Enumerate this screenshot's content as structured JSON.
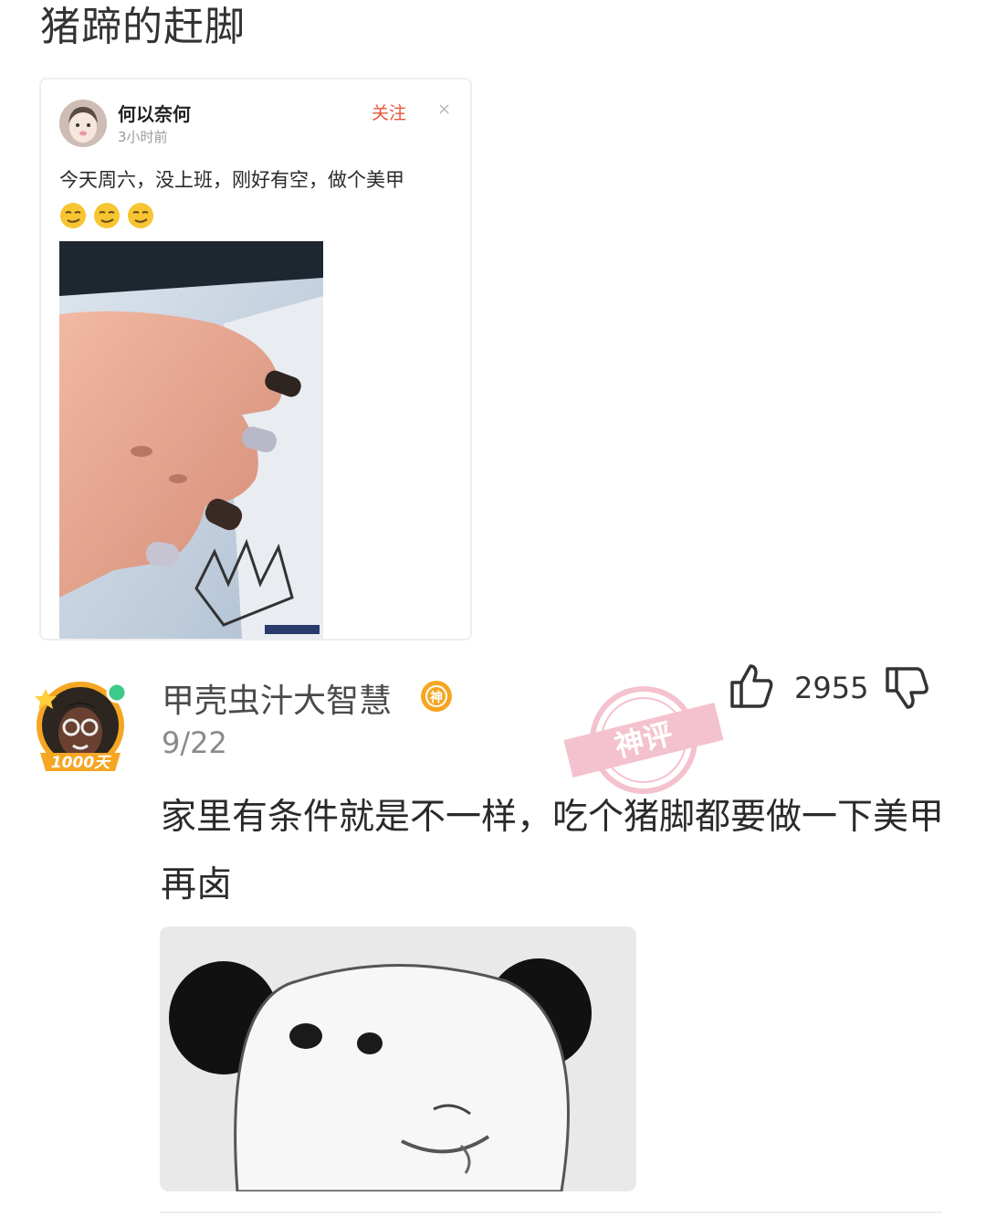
{
  "post": {
    "title": "猪蹄的赶脚"
  },
  "quoted_post": {
    "username": "何以奈何",
    "time": "3小时前",
    "follow_label": "关注",
    "close_symbol": "×",
    "text": "今天周六，没上班，刚好有空，做个美甲",
    "emojis": [
      "smirk-face",
      "smirk-face",
      "smirk-face"
    ]
  },
  "comment": {
    "username": "甲壳虫汁大智慧",
    "badge": "神",
    "avatar_badge": "1000天",
    "date": "9/22",
    "likes": "2955",
    "stamp": "神评",
    "text": "家里有条件就是不一样，吃个猪脚都要做一下美甲再卤"
  },
  "colors": {
    "accent_orange": "#f5a623",
    "follow_red": "#e8573a",
    "stamp_pink": "#f2b8c6",
    "online_green": "#3cc98a"
  }
}
